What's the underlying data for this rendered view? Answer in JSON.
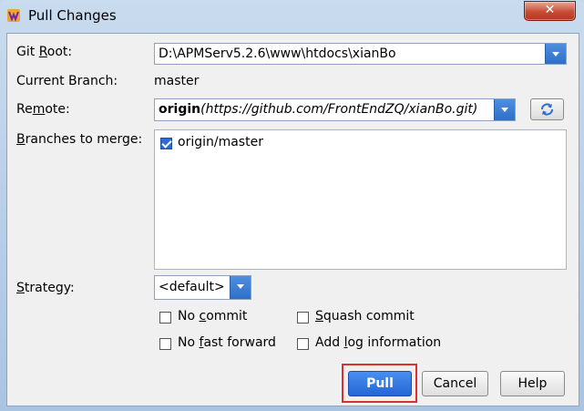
{
  "window": {
    "title": "Pull Changes",
    "close_glyph": "✕",
    "icon": "app-logo-icon"
  },
  "form": {
    "git_root_label_pre": "Git ",
    "git_root_label_mnemonic": "R",
    "git_root_label_post": "oot:",
    "git_root_value": "D:\\APMServ5.2.6\\www\\htdocs\\xianBo",
    "current_branch_label": "Current Branch:",
    "current_branch_value": "master",
    "remote_label_pre": "Re",
    "remote_label_mnemonic": "m",
    "remote_label_post": "ote:",
    "remote_name": "origin",
    "remote_url": "(https://github.com/FrontEndZQ/xianBo.git)",
    "branches_label_mnemonic": "B",
    "branches_label_post": "ranches to merge:",
    "branches": [
      {
        "label": "origin/master",
        "checked": true
      }
    ],
    "strategy_label_mnemonic": "S",
    "strategy_label_post": "trategy:",
    "strategy_value": "<default>",
    "options": {
      "no_commit_pre": "No ",
      "no_commit_mnemonic": "c",
      "no_commit_post": "ommit",
      "squash_mnemonic": "S",
      "squash_post": "quash commit",
      "no_ff_pre": "No ",
      "no_ff_mnemonic": "f",
      "no_ff_post": "ast forward",
      "add_log_pre": "Add ",
      "add_log_mnemonic": "l",
      "add_log_post": "og information"
    }
  },
  "buttons": {
    "pull": "Pull",
    "cancel": "Cancel",
    "help": "Help"
  },
  "colors": {
    "accent": "#2d6bd0",
    "highlight": "#d93030"
  }
}
